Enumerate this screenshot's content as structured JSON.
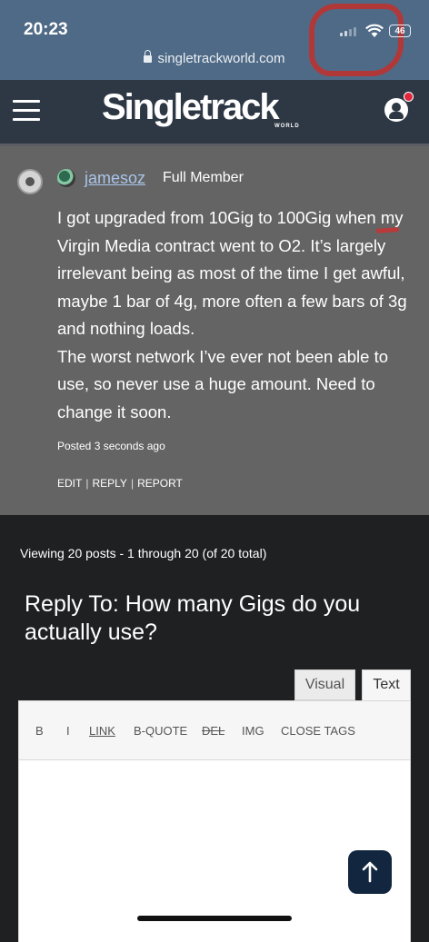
{
  "status_bar": {
    "time": "20:23",
    "battery": "46"
  },
  "browser": {
    "url": "singletrackworld.com"
  },
  "header": {
    "logo_text": "Singletrack",
    "logo_sub": "WORLD"
  },
  "post": {
    "username": "jamesoz",
    "role": "Full Member",
    "paragraphs": [
      "I got upgraded from 10Gig to 100Gig when my Virgin Media contract went to O2. It’s largely irrelevant being as most of the time I get awful, maybe 1 bar of 4g, more often a few bars of 3g and nothing loads.",
      "The worst network I’ve ever not been able to use, so never use a huge amount. Need to change it soon."
    ],
    "posted": "Posted 3 seconds ago",
    "actions": [
      "EDIT",
      "REPLY",
      "REPORT"
    ]
  },
  "viewing_text": "Viewing 20 posts - 1 through 20 (of 20 total)",
  "reply": {
    "title": "Reply To: How many Gigs do you actually use?",
    "tabs": [
      "Visual",
      "Text"
    ],
    "quicktags": [
      "B",
      "I",
      "LINK",
      "B-QUOTE",
      "DEL",
      "IMG",
      "CLOSE TAGS"
    ]
  },
  "colors": {
    "status_bg": "#4f6a86",
    "header_bg": "#2e3844",
    "post_bg": "#646464",
    "page_bg": "#1f2022",
    "username_link": "#a9c4e8",
    "scroll_button": "#12273f"
  },
  "icons": [
    "lock-icon",
    "menu-icon",
    "user-account-icon",
    "arrow-up-icon",
    "wifi-icon",
    "signal-icon"
  ]
}
